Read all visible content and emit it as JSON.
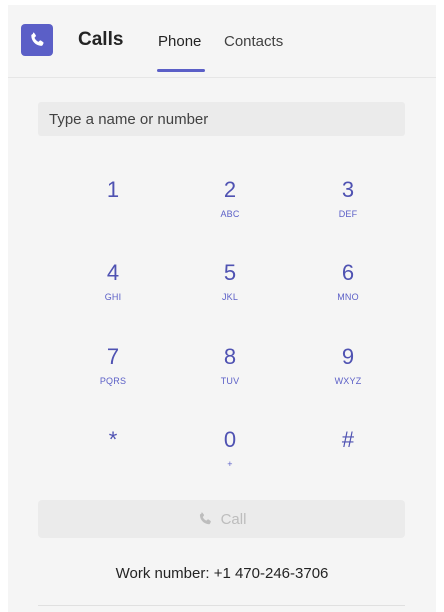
{
  "header": {
    "app_icon": "phone-icon",
    "title": "Calls",
    "tabs": [
      {
        "label": "Phone",
        "active": true
      },
      {
        "label": "Contacts",
        "active": false
      }
    ]
  },
  "search": {
    "placeholder": "Type a name or number",
    "value": ""
  },
  "dialpad": {
    "keys": [
      {
        "digit": "1",
        "letters": ""
      },
      {
        "digit": "2",
        "letters": "ABC"
      },
      {
        "digit": "3",
        "letters": "DEF"
      },
      {
        "digit": "4",
        "letters": "GHI"
      },
      {
        "digit": "5",
        "letters": "JKL"
      },
      {
        "digit": "6",
        "letters": "MNO"
      },
      {
        "digit": "7",
        "letters": "PQRS"
      },
      {
        "digit": "8",
        "letters": "TUV"
      },
      {
        "digit": "9",
        "letters": "WXYZ"
      },
      {
        "digit": "*",
        "letters": ""
      },
      {
        "digit": "0",
        "letters": "+"
      },
      {
        "digit": "#",
        "letters": ""
      }
    ]
  },
  "call_button": {
    "label": "Call",
    "icon": "phone-icon",
    "enabled": false
  },
  "work_number": "Work number: +1 470-246-3706",
  "colors": {
    "accent": "#5b5fc7",
    "digit": "#4f52b2",
    "panel_bg": "#f5f5f5",
    "disabled": "#bdbdbd"
  }
}
